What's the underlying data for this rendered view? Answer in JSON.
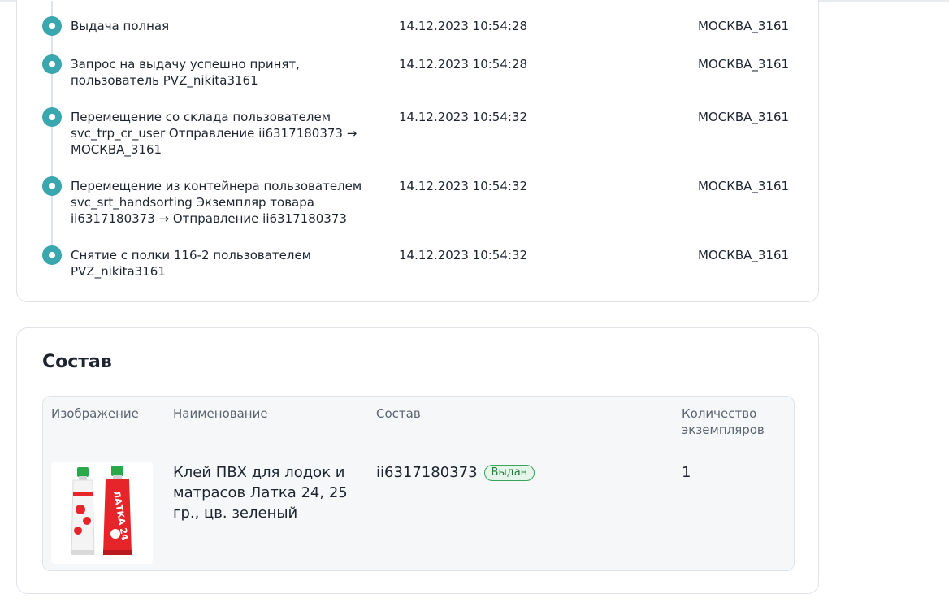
{
  "history": {
    "events": [
      {
        "description": "Выдача полная",
        "date": "14.12.2023 10:54:28",
        "place": "МОСКВА_3161"
      },
      {
        "description": "Запрос на выдачу успешно принят,\nпользователь PVZ_nikita3161",
        "date": "14.12.2023 10:54:28",
        "place": "МОСКВА_3161"
      },
      {
        "description": "Перемещение со склада пользователем\nsvc_trp_cr_user Отправление ii6317180373 →\nМОСКВА_3161",
        "date": "14.12.2023 10:54:32",
        "place": "МОСКВА_3161"
      },
      {
        "description": "Перемещение из контейнера пользователем\nsvc_srt_handsorting Экземпляр товара\nii6317180373 → Отправление ii6317180373",
        "date": "14.12.2023 10:54:32",
        "place": "МОСКВА_3161"
      },
      {
        "description": "Снятие с полки 116-2 пользователем\nPVZ_nikita3161",
        "date": "14.12.2023 10:54:32",
        "place": "МОСКВА_3161"
      }
    ]
  },
  "composition": {
    "title": "Состав",
    "columns": {
      "image": "Изображение",
      "name": "Наименование",
      "composition": "Состав",
      "quantity": "Количество\nэкземпляров"
    },
    "rows": [
      {
        "name": "Клей ПВХ для лодок и матрасов Латка 24, 25 гр., цв. зеленый",
        "item_id": "ii6317180373",
        "status": "Выдан",
        "quantity": "1",
        "product_label": "ЛАТКА 24"
      }
    ]
  },
  "colors": {
    "timeline_dot": "#3aa6ad",
    "badge_text": "#1f7a3a",
    "badge_border": "#3aa55a",
    "tube_red": "#e5252a",
    "tube_cap": "#2aa84a"
  }
}
